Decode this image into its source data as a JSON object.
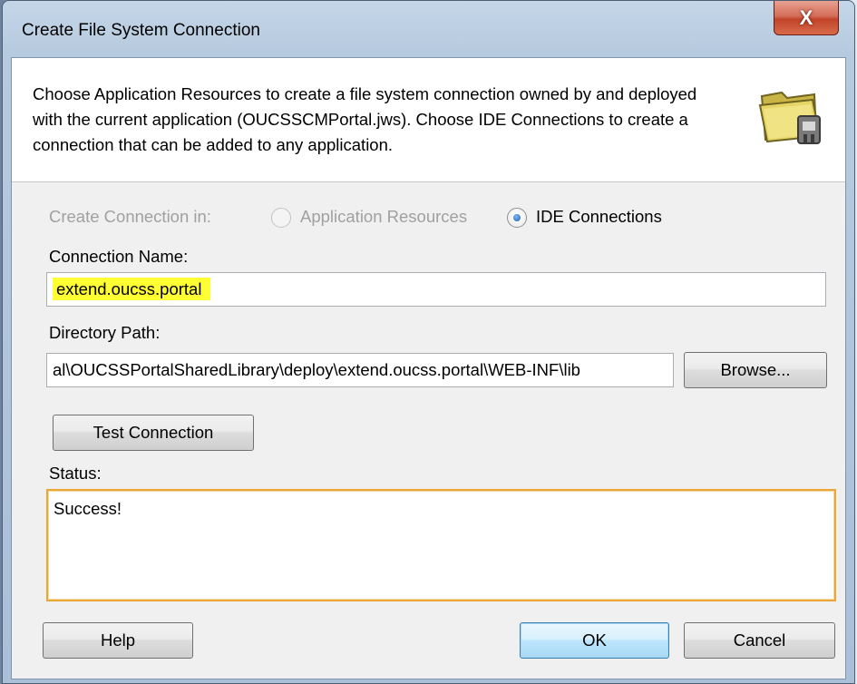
{
  "window": {
    "title": "Create File System Connection",
    "close_glyph": "X"
  },
  "header": {
    "description": "Choose Application Resources to create a file system connection owned by and deployed with the current application (OUCSSCMPortal.jws). Choose IDE Connections to create a connection that can be added to any application.",
    "icon": "folder-connection-icon"
  },
  "create_in": {
    "label": "Create Connection in:",
    "options": [
      {
        "label": "Application Resources",
        "selected": false,
        "enabled": false
      },
      {
        "label": "IDE Connections",
        "selected": true,
        "enabled": true
      }
    ]
  },
  "connection_name": {
    "label": "Connection Name:",
    "value": "extend.oucss.portal"
  },
  "directory_path": {
    "label": "Directory Path:",
    "value": "al\\OUCSSPortalSharedLibrary\\deploy\\extend.oucss.portal\\WEB-INF\\lib",
    "browse_label": "Browse..."
  },
  "test_connection": {
    "label": "Test Connection"
  },
  "status": {
    "label": "Status:",
    "value": "Success!"
  },
  "footer": {
    "help_label": "Help",
    "ok_label": "OK",
    "cancel_label": "Cancel"
  },
  "colors": {
    "highlight": "#ffff33",
    "status_border": "#e8a736",
    "default_button": "#3c7fb1"
  }
}
